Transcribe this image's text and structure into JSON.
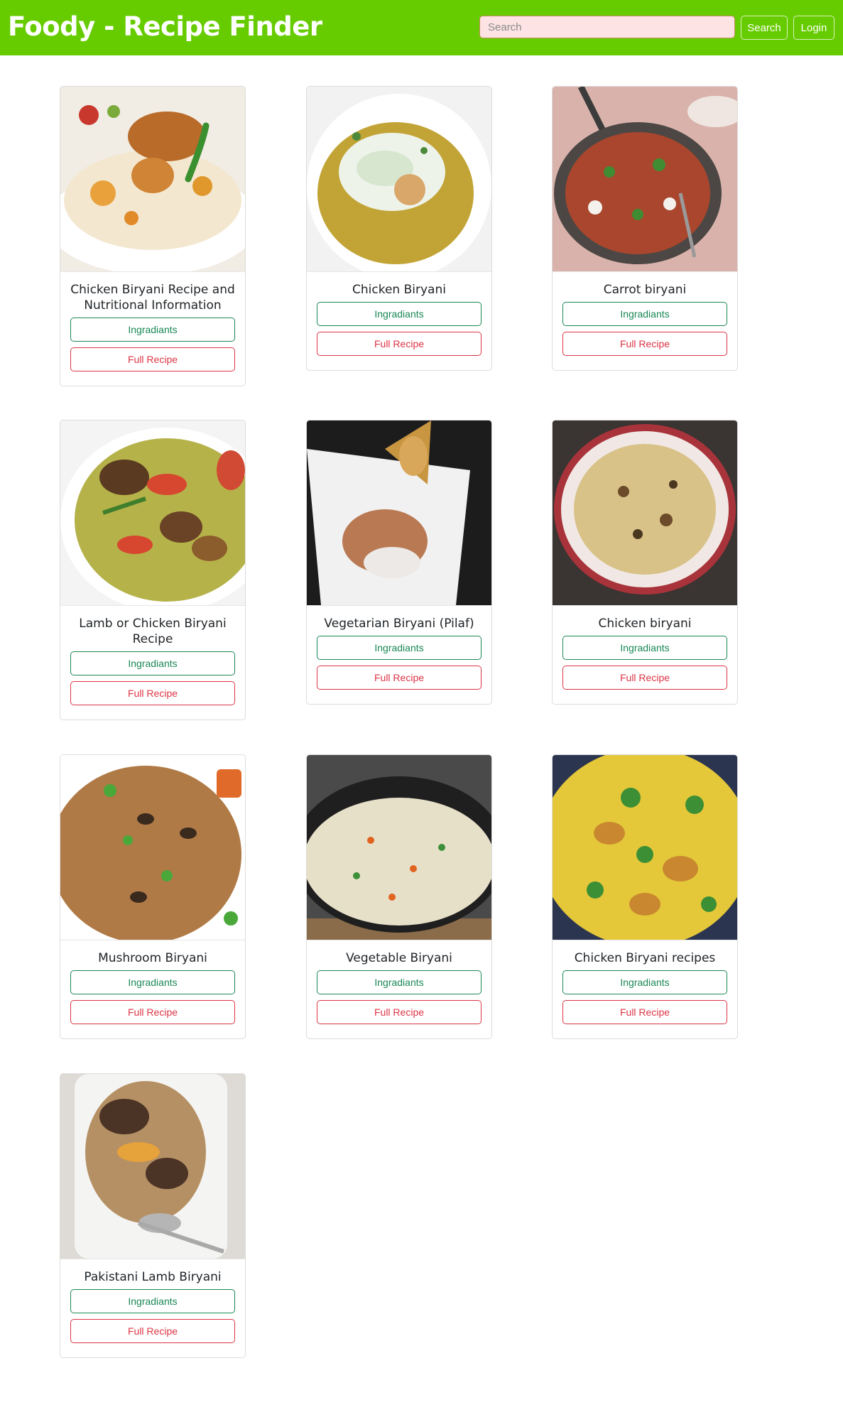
{
  "header": {
    "brand": "Foody - Recipe Finder",
    "search_placeholder": "Search",
    "search_button": "Search",
    "login_button": "Login",
    "bg_color": "#66cc00"
  },
  "buttons": {
    "ingredients_label": "Ingradiants",
    "full_recipe_label": "Full Recipe",
    "ingredients_color": "#198754",
    "full_recipe_color": "#dc3545"
  },
  "recipes": [
    {
      "title": "Chicken Biryani Recipe and Nutritional Information",
      "image": "chicken-biryani-plate-photo"
    },
    {
      "title": "Chicken Biryani",
      "image": "chicken-biryani-raita-photo"
    },
    {
      "title": "Carrot biryani",
      "image": "carrot-biryani-pan-photo"
    },
    {
      "title": "Lamb or Chicken Biryani Recipe",
      "image": "lamb-biryani-photo"
    },
    {
      "title": "Vegetarian Biryani (Pilaf)",
      "image": "vegetarian-biryani-photo"
    },
    {
      "title": "Chicken biryani",
      "image": "chicken-biryani-bowl-photo"
    },
    {
      "title": "Mushroom Biryani",
      "image": "mushroom-biryani-photo"
    },
    {
      "title": "Vegetable Biryani",
      "image": "vegetable-biryani-photo"
    },
    {
      "title": "Chicken Biryani recipes",
      "image": "chicken-biryani-pot-photo"
    },
    {
      "title": "Pakistani Lamb Biryani",
      "image": "pakistani-lamb-biryani-photo"
    }
  ]
}
